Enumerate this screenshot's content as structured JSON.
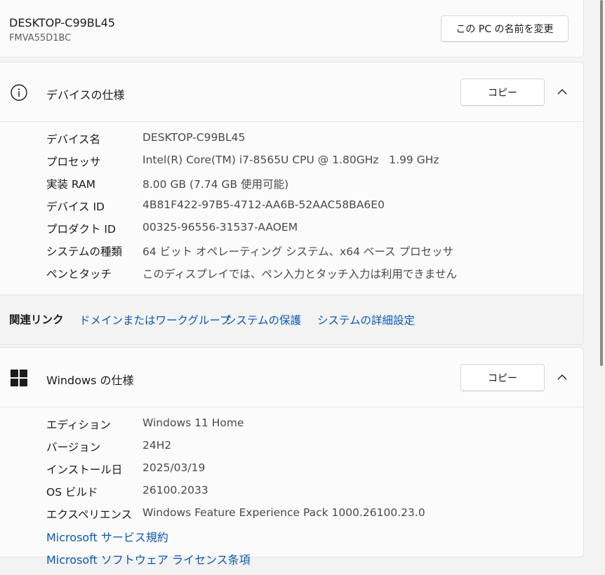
{
  "pc": {
    "name": "DESKTOP-C99BL45",
    "model": "FMVA55D1BC",
    "rename_label": "この PC の名前を変更"
  },
  "device_spec": {
    "title": "デバイスの仕様",
    "copy_label": "コピー",
    "icon": "info-icon",
    "rows": [
      {
        "key": "デバイス名",
        "value": "DESKTOP-C99BL45"
      },
      {
        "key": "プロセッサ",
        "value": "Intel(R) Core(TM) i7-8565U CPU @ 1.80GHz   1.99 GHz"
      },
      {
        "key": "実装 RAM",
        "value": "8.00 GB (7.74 GB 使用可能)"
      },
      {
        "key": "デバイス ID",
        "value": "4B81F422-97B5-4712-AA6B-52AAC58BA6E0"
      },
      {
        "key": "プロダクト ID",
        "value": "00325-96556-31537-AAOEM"
      },
      {
        "key": "システムの種類",
        "value": "64 ビット オペレーティング システム、x64 ベース プロセッサ"
      },
      {
        "key": "ペンとタッチ",
        "value": "このディスプレイでは、ペン入力とタッチ入力は利用できません"
      }
    ]
  },
  "related_links": {
    "label": "関連リンク",
    "items": [
      "ドメインまたはワークグループ",
      "システムの保護",
      "システムの詳細設定"
    ]
  },
  "windows_spec": {
    "title": "Windows の仕様",
    "copy_label": "コピー",
    "icon": "windows-logo-icon",
    "rows": [
      {
        "key": "エディション",
        "value": "Windows 11 Home"
      },
      {
        "key": "バージョン",
        "value": "24H2"
      },
      {
        "key": "インストール日",
        "value": "2025/03/19"
      },
      {
        "key": "OS ビルド",
        "value": "26100.2033"
      },
      {
        "key": "エクスペリエンス",
        "value": "Windows Feature Experience Pack 1000.26100.23.0"
      }
    ],
    "links": [
      "Microsoft サービス規約",
      "Microsoft ソフトウェア ライセンス条項"
    ]
  },
  "colors": {
    "link": "#0a58b5",
    "card_bg": "#fbfbfb",
    "page_bg": "#f3f3f3"
  }
}
